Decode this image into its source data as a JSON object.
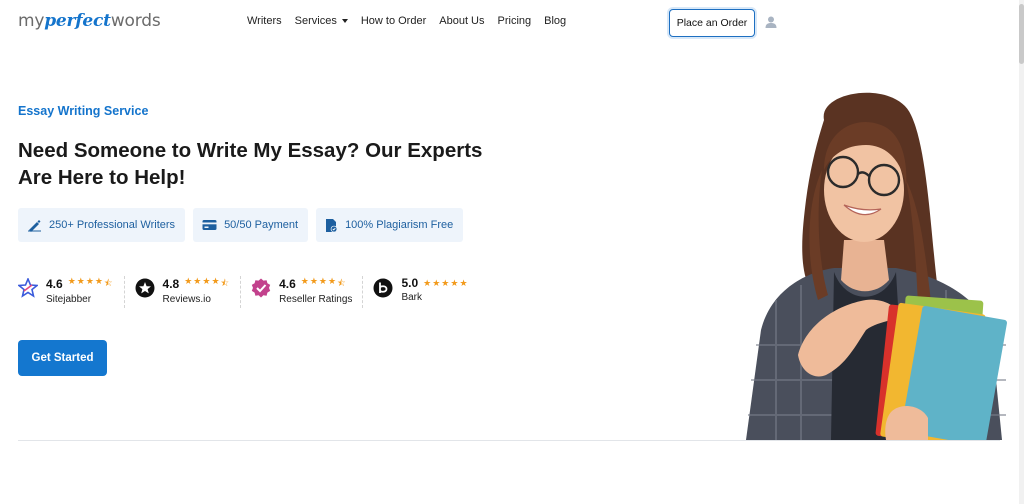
{
  "header": {
    "logo": {
      "part1": "my",
      "part2": "perfect",
      "part3": "words"
    },
    "nav": [
      {
        "label": "Writers"
      },
      {
        "label": "Services",
        "has_dropdown": true
      },
      {
        "label": "How to Order"
      },
      {
        "label": "About Us"
      },
      {
        "label": "Pricing"
      },
      {
        "label": "Blog"
      }
    ],
    "order_button": "Place an Order",
    "user_icon": "user-icon"
  },
  "hero": {
    "eyebrow": "Essay Writing Service",
    "title": "Need Someone to Write My Essay? Our Experts Are Here to Help!",
    "features": [
      {
        "icon": "writer-pen-icon",
        "label": "250+ Professional Writers"
      },
      {
        "icon": "card-payment-icon",
        "label": "50/50 Payment"
      },
      {
        "icon": "document-check-icon",
        "label": "100% Plagiarism Free"
      }
    ],
    "ratings": [
      {
        "score": "4.6",
        "name": "Sitejabber",
        "stars": 4.5,
        "icon": "sitejabber-logo"
      },
      {
        "score": "4.8",
        "name": "Reviews.io",
        "stars": 4.5,
        "icon": "reviewsio-logo"
      },
      {
        "score": "4.6",
        "name": "Reseller Ratings",
        "stars": 4.5,
        "icon": "resellerratings-logo"
      },
      {
        "score": "5.0",
        "name": "Bark",
        "stars": 5,
        "icon": "bark-logo"
      }
    ],
    "cta": "Get Started"
  },
  "colors": {
    "brand": "#1474cc",
    "star": "#f29a1b",
    "feature_bg": "#eef4fb"
  }
}
